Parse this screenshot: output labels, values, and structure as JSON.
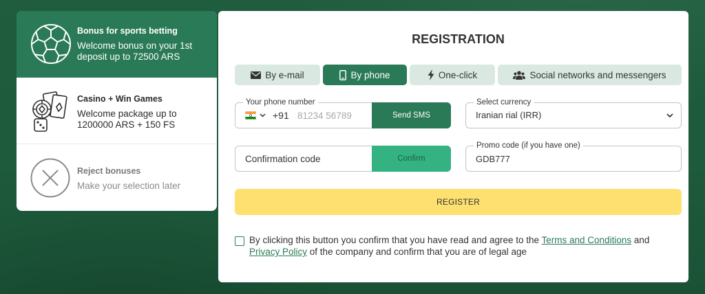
{
  "colors": {
    "brand_green": "#2b7a57",
    "confirm_green": "#34b281",
    "tab_bg": "#d9e9e2",
    "register_yellow": "#fde070",
    "background": "#1e5a3c"
  },
  "bonuses": {
    "items": [
      {
        "title": "Bonus for sports betting",
        "description": "Welcome bonus on your 1st deposit up to 72500 ARS",
        "icon": "soccer-ball-icon",
        "selected": true
      },
      {
        "title": "Casino + Win Games",
        "description": "Welcome package up to 1200000 ARS + 150 FS",
        "icon": "casino-chips-cards-dice-icon",
        "selected": false
      },
      {
        "title": "Reject bonuses",
        "description": "Make your selection later",
        "icon": "close-circle-icon",
        "selected": false
      }
    ]
  },
  "form": {
    "title": "REGISTRATION",
    "tabs": [
      {
        "label": "By e-mail",
        "icon": "envelope-icon",
        "active": false
      },
      {
        "label": "By phone",
        "icon": "mobile-phone-icon",
        "active": true
      },
      {
        "label": "One-click",
        "icon": "lightning-icon",
        "active": false
      },
      {
        "label": "Social networks and messengers",
        "icon": "users-group-icon",
        "active": false
      }
    ],
    "phone": {
      "label": "Your phone number",
      "country_flag_icon": "india-flag-icon",
      "country_code": "+91",
      "placeholder": "81234 56789",
      "button": "Send SMS"
    },
    "currency": {
      "label": "Select currency",
      "value": "Iranian rial (IRR)"
    },
    "confirmation": {
      "placeholder": "Confirmation code",
      "button": "Confirm"
    },
    "promo": {
      "label": "Promo code (if you have one)",
      "value": "GDB777"
    },
    "register_button": "REGISTER",
    "agreement": {
      "checked": false,
      "text_before": "By clicking this button you confirm that you have read and agree to the",
      "terms_link": "Terms and Conditions",
      "text_middle": "and",
      "privacy_link": "Privacy Policy",
      "text_after": "of the company and confirm that you are of legal age"
    }
  }
}
